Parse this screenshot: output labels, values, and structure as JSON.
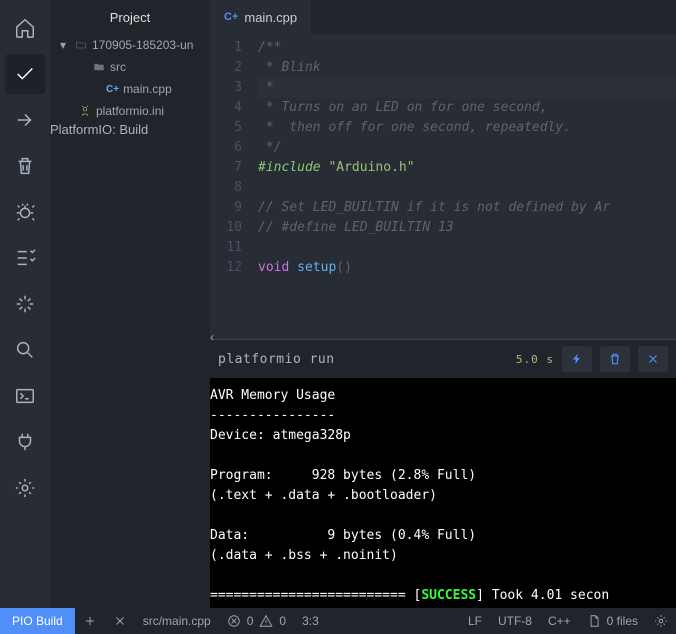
{
  "sidebar": {
    "title": "Project"
  },
  "tree": {
    "root": {
      "name": "170905-185203-un"
    },
    "file1": "src",
    "file2": "main.cpp",
    "file3": "platformio.ini",
    "tooltip": "PlatformIO: Build"
  },
  "tab": {
    "label": "main.cpp",
    "icon_prefix": "C+"
  },
  "code": {
    "lines": [
      "1",
      "2",
      "3",
      "4",
      "5",
      "6",
      "7",
      "8",
      "9",
      "10",
      "11",
      "12"
    ],
    "l1": "/**",
    "l2": " * Blink",
    "l3": " *",
    "l4": " * Turns on an LED on for one second,",
    "l5": " *  then off for one second, repeatedly.",
    "l6": " */",
    "l7_a": "#include",
    "l7_b": "\"Arduino.h\"",
    "l9": "// Set LED_BUILTIN if it is not defined by Ar",
    "l10": "// #define LED_BUILTIN 13",
    "l12_a": "void",
    "l12_b": "setup",
    "l12_c": "()"
  },
  "terminal": {
    "cmd": "platformio run",
    "time": "5.0 s",
    "body": "AVR Memory Usage\n----------------\nDevice: atmega328p\n\nProgram:     928 bytes (2.8% Full)\n(.text + .data + .bootloader)\n\nData:          9 bytes (0.4% Full)\n(.data + .bss + .noinit)\n",
    "tail_a": "========================= [",
    "tail_b": "SUCCESS",
    "tail_c": "] Took 4.01 secon"
  },
  "status": {
    "pio": "PIO Build",
    "file": "src/main.cpp",
    "err": "0",
    "warn": "0",
    "cursor": "3:3",
    "eol": "LF",
    "enc": "UTF-8",
    "lang": "C++",
    "files": "0 files"
  }
}
